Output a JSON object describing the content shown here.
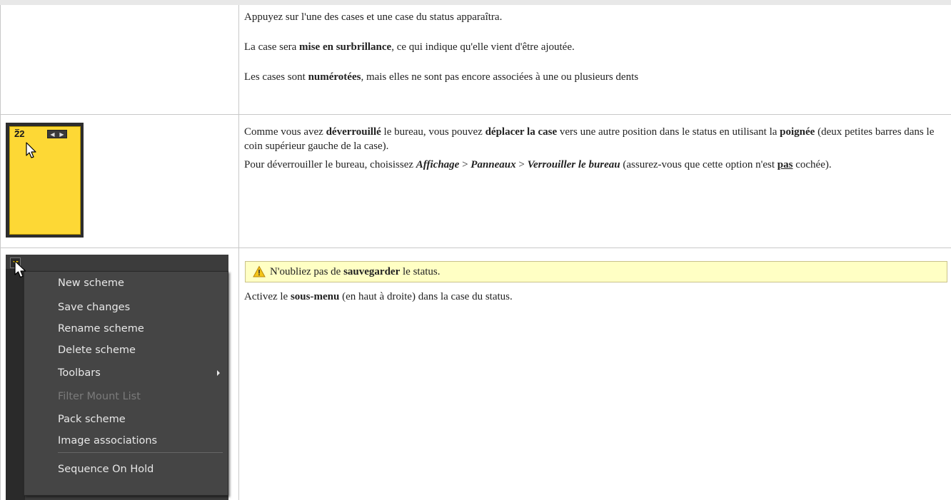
{
  "rows": [
    {
      "paragraphs": [
        [
          "Appuyez sur l'une des cases et une case du status apparaîtra."
        ],
        [
          "La case sera ",
          {
            "b": "mise en surbrillance"
          },
          ", ce qui indique qu'elle vient d'être ajoutée."
        ],
        [
          "Les cases sont ",
          {
            "b": "numérotées"
          },
          ", mais elles ne sont pas encore associées à une ou plusieurs dents"
        ]
      ]
    },
    {
      "image": {
        "case_number": "22"
      },
      "paragraphs": [
        [
          "Comme vous avez ",
          {
            "b": "déverrouillé"
          },
          " le bureau, vous pouvez ",
          {
            "b": "déplacer la case"
          },
          " vers une autre position dans le status en utilisant la ",
          {
            "b": "poignée"
          },
          " (deux petites barres dans le coin supérieur gauche de la case)."
        ],
        [
          "Pour déverrouiller le bureau, choisissez ",
          {
            "bi": "Affichage"
          },
          " > ",
          {
            "bi": "Panneaux"
          },
          " > ",
          {
            "bi": "Verrouiller le bureau"
          },
          " (assurez-vous que cette option n'est ",
          {
            "u": "pas"
          },
          " cochée)."
        ]
      ]
    },
    {
      "note": [
        "N'oubliez pas de ",
        {
          "b": "sauvegarder"
        },
        " le status."
      ],
      "paragraphs": [
        [
          "Activez le ",
          {
            "b": "sous-menu"
          },
          " (en haut à droite) dans la case du status."
        ]
      ],
      "menu": {
        "items": [
          {
            "label": "New scheme",
            "enabled": true
          },
          {
            "label": "Save changes",
            "enabled": true
          },
          {
            "label": "Rename scheme",
            "enabled": true
          },
          {
            "label": "Delete scheme",
            "enabled": true
          },
          {
            "label": "Toolbars",
            "enabled": true,
            "submenu": true
          },
          {
            "label": "Filter Mount List",
            "enabled": false
          },
          {
            "label": "Pack scheme",
            "enabled": true
          },
          {
            "label": "Image associations",
            "enabled": true
          },
          {
            "label": "Sequence On Hold",
            "enabled": true
          }
        ]
      }
    }
  ],
  "colors": {
    "case_yellow": "#fdd835",
    "note_bg": "#ffffc4",
    "menu_bg": "#454545"
  }
}
